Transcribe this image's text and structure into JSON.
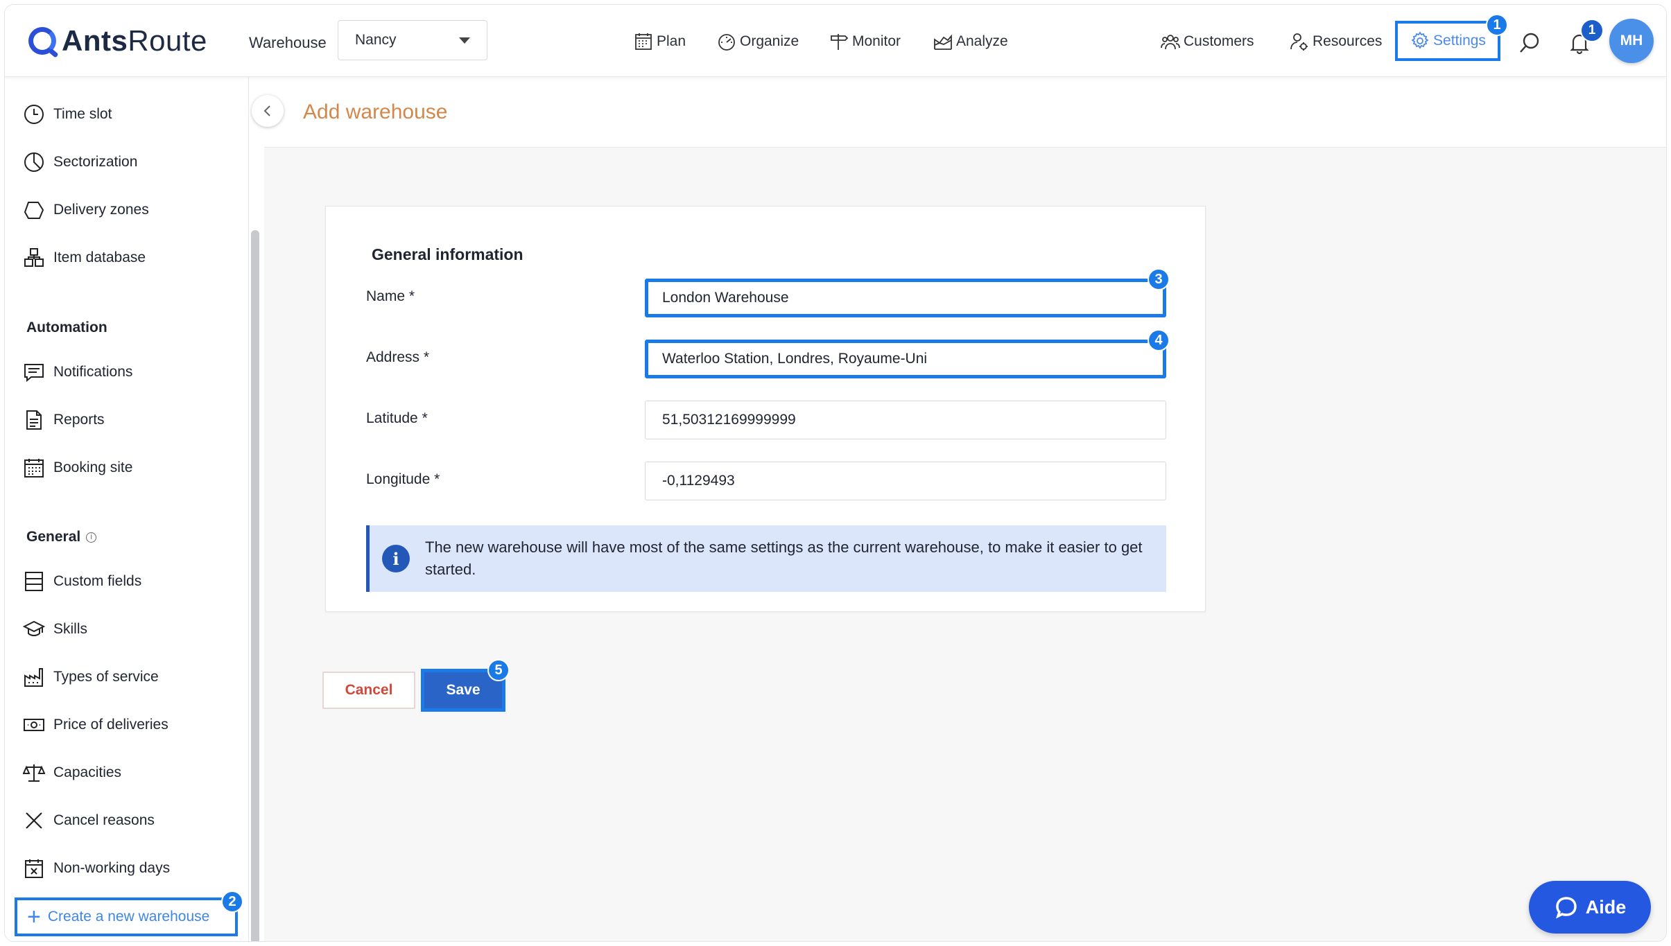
{
  "app": {
    "brand_bold": "Ants",
    "brand_light": "Route"
  },
  "header": {
    "warehouse_label": "Warehouse",
    "warehouse_value": "Nancy",
    "nav": {
      "plan": "Plan",
      "organize": "Organize",
      "monitor": "Monitor",
      "analyze": "Analyze",
      "customers": "Customers",
      "resources": "Resources",
      "settings": "Settings"
    },
    "notification_count": "1",
    "avatar_initials": "MH"
  },
  "sidebar": {
    "items_top": [
      "Time slot",
      "Sectorization",
      "Delivery zones",
      "Item database"
    ],
    "section_automation": "Automation",
    "items_automation": [
      "Notifications",
      "Reports",
      "Booking site"
    ],
    "section_general": "General",
    "items_general": [
      "Custom fields",
      "Skills",
      "Types of service",
      "Price of deliveries",
      "Capacities",
      "Cancel reasons",
      "Non-working days"
    ],
    "create_warehouse": "Create a new warehouse"
  },
  "page": {
    "title": "Add warehouse",
    "section_title": "General information",
    "fields": {
      "name_label": "Name *",
      "name_value": "London Warehouse",
      "address_label": "Address *",
      "address_value": "Waterloo Station, Londres, Royaume-Uni",
      "latitude_label": "Latitude *",
      "latitude_value": "51,50312169999999",
      "longitude_label": "Longitude *",
      "longitude_value": "-0,1129493"
    },
    "info_message": "The new warehouse will have most of the same settings as the current warehouse, to make it easier to get started.",
    "cancel_label": "Cancel",
    "save_label": "Save"
  },
  "steps": [
    "1",
    "2",
    "3",
    "4",
    "5"
  ],
  "help_button": "Aide",
  "colors": {
    "accent": "#1a7be8",
    "title": "#d4874a",
    "save": "#2a64c7",
    "cancel": "#d04a3a"
  }
}
